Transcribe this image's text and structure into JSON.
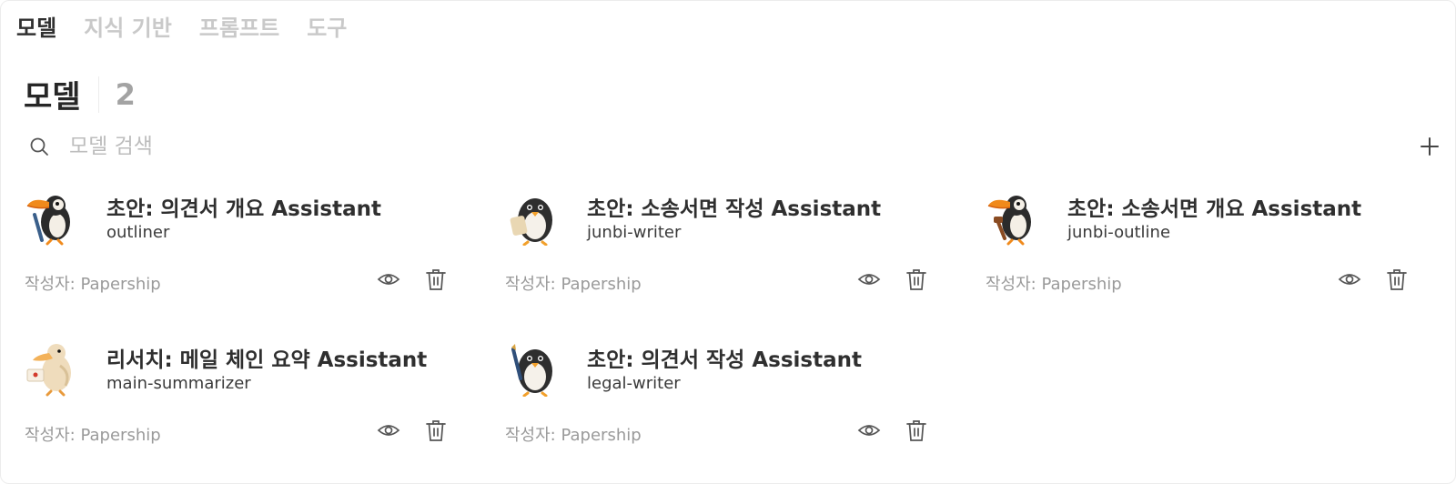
{
  "tabs": [
    {
      "label": "모델",
      "active": true
    },
    {
      "label": "지식 기반",
      "active": false
    },
    {
      "label": "프롬프트",
      "active": false
    },
    {
      "label": "도구",
      "active": false
    }
  ],
  "header": {
    "title": "모델",
    "count": "2"
  },
  "search": {
    "placeholder": "모델 검색",
    "value": ""
  },
  "models": [
    {
      "title": "초안: 의견서 개요 Assistant",
      "id": "outliner",
      "author": "작성자: Papership",
      "avatar": "toucan-icon"
    },
    {
      "title": "초안: 소송서면 작성 Assistant",
      "id": "junbi-writer",
      "author": "작성자: Papership",
      "avatar": "penguin-icon"
    },
    {
      "title": "초안: 소송서면 개요 Assistant",
      "id": "junbi-outline",
      "author": "작성자: Papership",
      "avatar": "toucan-icon"
    },
    {
      "title": "리서치: 메일 체인 요약 Assistant",
      "id": "main-summarizer",
      "author": "작성자: Papership",
      "avatar": "pelican-icon"
    },
    {
      "title": "초안: 의견서 작성 Assistant",
      "id": "legal-writer",
      "author": "작성자: Papership",
      "avatar": "penguin-icon"
    }
  ],
  "colors": {
    "active_tab": "#303030",
    "inactive_tab": "#c9c9c9",
    "muted_text": "#9a9a9a",
    "icon": "#555555"
  }
}
